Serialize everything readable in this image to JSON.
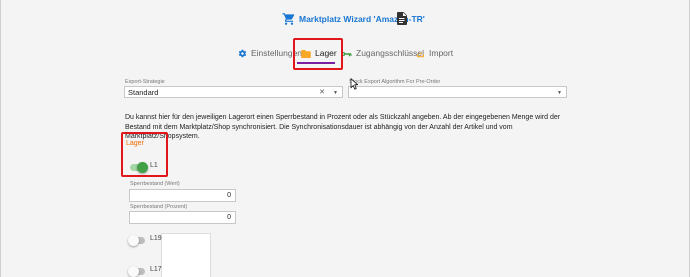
{
  "header": {
    "title": "Marktplatz Wizard 'Amazon-TR'",
    "cart_icon": "cart-icon",
    "doc_icon": "document-icon",
    "accent": "#1976d2"
  },
  "tabs": [
    {
      "label": "Einstellungen",
      "icon": "gear-icon",
      "active": false
    },
    {
      "label": "Lager",
      "icon": "folder-icon",
      "active": true
    },
    {
      "label": "Zugangsschlüssel",
      "icon": "key-icon",
      "active": false
    },
    {
      "label": "Import",
      "icon": "import-icon",
      "active": false
    }
  ],
  "export": {
    "label": "Export-Strategie",
    "value": "Standard"
  },
  "stock_algo": {
    "label": "Stock Export Algorithm For Pre-Order",
    "value": ""
  },
  "description": "Du kannst hier für den jeweiligen Lagerort einen Sperrbestand in Prozent oder als Stückzahl angeben. Ab der eingegebenen Menge wird der Bestand mit dem Marktplatz/Shop synchronisiert. Die Synchronisationsdauer ist abhängig von der Anzahl der Artikel und vom Marktplatz/Shopsystem.",
  "lager_section": {
    "label": "Lager",
    "label_color": "#ef6c00"
  },
  "locations": [
    {
      "name": "L1",
      "enabled": true
    },
    {
      "name": "L19",
      "enabled": false
    },
    {
      "name": "L17",
      "enabled": false
    }
  ],
  "sperrbestand_wert": {
    "label": "Sperrbestand (Wert)",
    "value": "0"
  },
  "sperrbestand_prozent": {
    "label": "Sperrbestand (Prozent)",
    "value": "0"
  },
  "highlight_color": "#e0161b"
}
